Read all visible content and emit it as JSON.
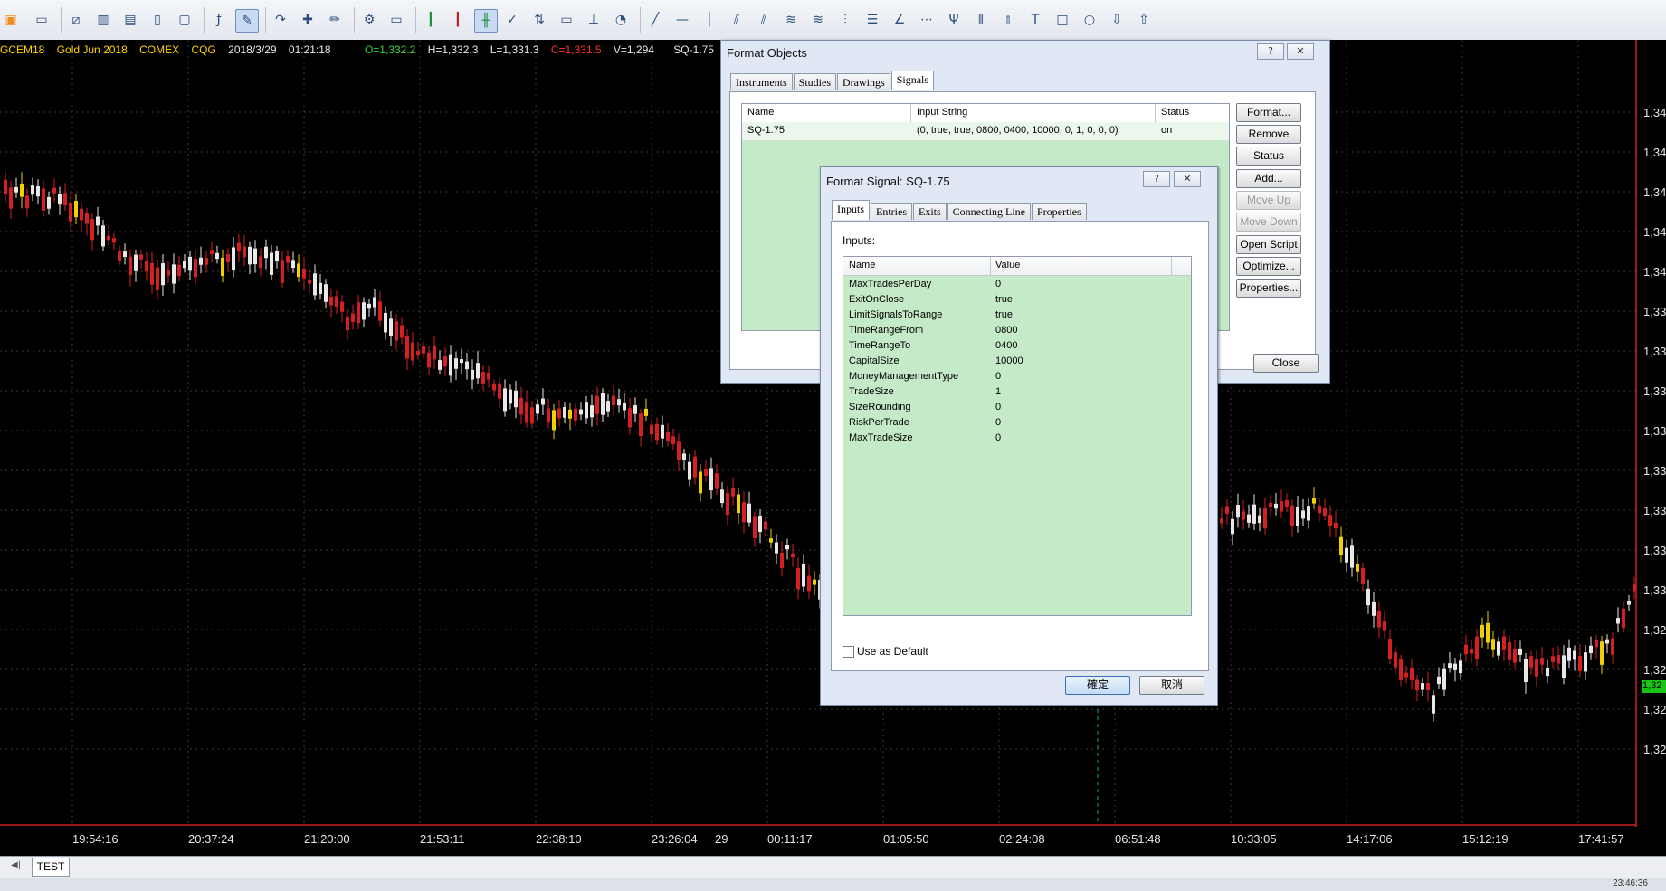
{
  "toolbar": {
    "buttons": [
      "new-chart",
      "save",
      "print-preview",
      "bar-chart",
      "table",
      "document",
      "line-study",
      "function",
      "draw-cursor",
      "redo",
      "add-study",
      "draw-mode",
      "settings",
      "display",
      "candle-chart",
      "bar-chart-red",
      "hlc-chart",
      "checkmark",
      "up-down-arrows",
      "comment",
      "horizontal-line",
      "gauge",
      "line",
      "hline",
      "vline",
      "parallel",
      "channel",
      "fibonacci",
      "fib-fan",
      "gann",
      "retracement",
      "angle",
      "elliott",
      "pitchfork",
      "time-lines",
      "speed-lines",
      "text",
      "rectangle",
      "ellipse",
      "arrow-down",
      "arrow-up"
    ]
  },
  "quote_bar": {
    "symbol": "GCEM18",
    "description": "Gold Jun 2018",
    "exchange": "COMEX",
    "feed": "CQG",
    "date": "2018/3/29",
    "time": "01:21:18",
    "open": "O=1,332.2",
    "high": "H=1,332.3",
    "low": "L=1,331.3",
    "close": "C=1,331.5",
    "volume": "V=1,294",
    "signal": "SQ-1.75"
  },
  "time_axis": [
    "19:54:16",
    "20:37:24",
    "21:20:00",
    "21:53:11",
    "22:38:10",
    "23:26:04",
    "29",
    "00:11:17",
    "01:05:50",
    "02:24:08",
    "06:51:48",
    "10:33:05",
    "14:17:06",
    "15:12:19",
    "17:41:57"
  ],
  "price_axis": [
    "1,34",
    "1,34",
    "1,34",
    "1,34",
    "1,34",
    "1,33",
    "1,33",
    "1,33",
    "1,33",
    "1,33",
    "1,33",
    "1,33",
    "1,33",
    "1,32",
    "1,32",
    "1,32",
    "1,32"
  ],
  "price_badge": "1,32",
  "bottom_tabs": {
    "sheet": "TEST"
  },
  "status_clock": "23:46:36",
  "format_objects": {
    "title": "Format Objects",
    "help": "?",
    "close_x": "✕",
    "tabs": [
      "Instruments",
      "Studies",
      "Drawings",
      "Signals"
    ],
    "active_tab": "Signals",
    "columns": [
      "Name",
      "Input String",
      "Status"
    ],
    "rows": [
      {
        "name": "SQ-1.75",
        "input": "(0, true, true, 0800, 0400, 10000, 0, 1, 0, 0, 0)",
        "status": "on"
      }
    ],
    "buttons": {
      "format": "Format...",
      "remove": "Remove",
      "status": "Status",
      "add": "Add...",
      "move_up": "Move Up",
      "move_down": "Move Down",
      "open_script": "Open Script",
      "optimize": "Optimize...",
      "properties": "Properties..."
    },
    "close": "Close"
  },
  "format_signal": {
    "title": "Format Signal: SQ-1.75",
    "help": "?",
    "close_x": "✕",
    "tabs": [
      "Inputs",
      "Entries",
      "Exits",
      "Connecting Line",
      "Properties"
    ],
    "active_tab": "Inputs",
    "inputs_label": "Inputs:",
    "columns": [
      "Name",
      "Value"
    ],
    "params": [
      {
        "name": "MaxTradesPerDay",
        "value": "0"
      },
      {
        "name": "ExitOnClose",
        "value": "true"
      },
      {
        "name": "LimitSignalsToRange",
        "value": "true"
      },
      {
        "name": "TimeRangeFrom",
        "value": "0800"
      },
      {
        "name": "TimeRangeTo",
        "value": "0400"
      },
      {
        "name": "CapitalSize",
        "value": "10000"
      },
      {
        "name": "MoneyManagementType",
        "value": "0"
      },
      {
        "name": "TradeSize",
        "value": "1"
      },
      {
        "name": "SizeRounding",
        "value": "0"
      },
      {
        "name": "RiskPerTrade",
        "value": "0"
      },
      {
        "name": "MaxTradeSize",
        "value": "0"
      }
    ],
    "use_default": "Use as Default",
    "use_default_checked": false,
    "ok": "確定",
    "cancel": "取消"
  },
  "colors": {
    "up": "#e8e8e8",
    "down": "#d42020",
    "doji": "#f0d000",
    "axis": "#cc2020",
    "grid": "#3a3a3a",
    "grid_highlight": "#16a6a6"
  }
}
